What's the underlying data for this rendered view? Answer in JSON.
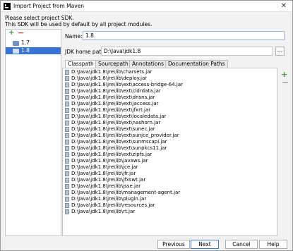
{
  "window": {
    "title": "Import Project from Maven",
    "close_glyph": "✕"
  },
  "header": {
    "line1": "Please select project SDK.",
    "line2": "This SDK will be used by default by all project modules."
  },
  "sdk_list": {
    "add_glyph": "+",
    "remove_glyph": "−",
    "items": [
      {
        "label": "1.7",
        "selected": false
      },
      {
        "label": "1.8",
        "selected": true
      }
    ]
  },
  "form": {
    "name_label": "Name:",
    "name_value": "1.8",
    "home_label": "JDK home path:",
    "home_value": "D:\\Java\\jdk1.8",
    "browse_label": "..."
  },
  "tabs": [
    "Classpath",
    "Sourcepath",
    "Annotations",
    "Documentation Paths"
  ],
  "active_tab": 0,
  "classpath": [
    "D:\\Java\\jdk1.8\\jre\\lib\\charsets.jar",
    "D:\\Java\\jdk1.8\\jre\\lib\\deploy.jar",
    "D:\\Java\\jdk1.8\\jre\\lib\\ext\\access-bridge-64.jar",
    "D:\\Java\\jdk1.8\\jre\\lib\\ext\\cldrdata.jar",
    "D:\\Java\\jdk1.8\\jre\\lib\\ext\\dnsns.jar",
    "D:\\Java\\jdk1.8\\jre\\lib\\ext\\jaccess.jar",
    "D:\\Java\\jdk1.8\\jre\\lib\\ext\\jfxrt.jar",
    "D:\\Java\\jdk1.8\\jre\\lib\\ext\\localedata.jar",
    "D:\\Java\\jdk1.8\\jre\\lib\\ext\\nashorn.jar",
    "D:\\Java\\jdk1.8\\jre\\lib\\ext\\sunec.jar",
    "D:\\Java\\jdk1.8\\jre\\lib\\ext\\sunjce_provider.jar",
    "D:\\Java\\jdk1.8\\jre\\lib\\ext\\sunmscapi.jar",
    "D:\\Java\\jdk1.8\\jre\\lib\\ext\\sunpkcs11.jar",
    "D:\\Java\\jdk1.8\\jre\\lib\\ext\\zipfs.jar",
    "D:\\Java\\jdk1.8\\jre\\lib\\javaws.jar",
    "D:\\Java\\jdk1.8\\jre\\lib\\jce.jar",
    "D:\\Java\\jdk1.8\\jre\\lib\\jfr.jar",
    "D:\\Java\\jdk1.8\\jre\\lib\\jfxswt.jar",
    "D:\\Java\\jdk1.8\\jre\\lib\\jsse.jar",
    "D:\\Java\\jdk1.8\\jre\\lib\\management-agent.jar",
    "D:\\Java\\jdk1.8\\jre\\lib\\plugin.jar",
    "D:\\Java\\jdk1.8\\jre\\lib\\resources.jar",
    "D:\\Java\\jdk1.8\\jre\\lib\\rt.jar"
  ],
  "side_toolbar": {
    "add_glyph": "+",
    "remove_glyph": "−"
  },
  "buttons": {
    "previous": "Previous",
    "next": "Next",
    "cancel": "Cancel",
    "help": "Help"
  }
}
